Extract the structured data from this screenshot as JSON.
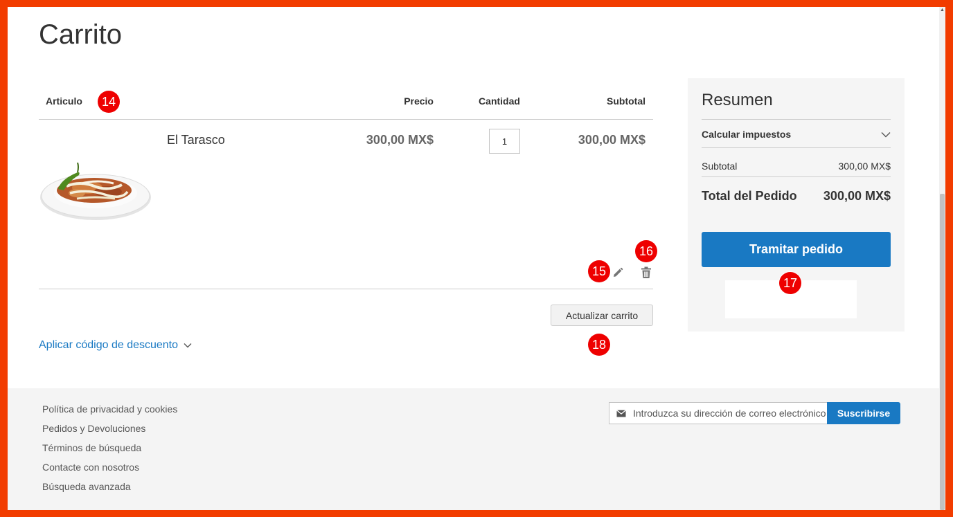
{
  "page": {
    "title": "Carrito"
  },
  "cart": {
    "headers": {
      "item": "Articulo",
      "price": "Precio",
      "qty": "Cantidad",
      "subtotal": "Subtotal"
    },
    "items": [
      {
        "name": "El Tarasco",
        "price": "300,00 MX$",
        "qty": "1",
        "subtotal": "300,00 MX$"
      }
    ],
    "update_label": "Actualizar carrito",
    "discount_label": "Aplicar código de descuento"
  },
  "summary": {
    "title": "Resumen",
    "tax_label": "Calcular impuestos",
    "subtotal_label": "Subtotal",
    "subtotal_value": "300,00 MX$",
    "total_label": "Total del Pedido",
    "total_value": "300,00 MX$",
    "checkout_label": "Tramitar pedido"
  },
  "footer": {
    "links": [
      "Política de privacidad y cookies",
      "Pedidos y Devoluciones",
      "Términos de búsqueda",
      "Contacte con nosotros",
      "Búsqueda avanzada"
    ],
    "newsletter_placeholder": "Introduzca su dirección de correo electrónico",
    "subscribe_label": "Suscribirse"
  },
  "badges": [
    "14",
    "15",
    "16",
    "17",
    "18"
  ],
  "icons": {
    "edit": "pencil-icon",
    "delete": "trash-icon",
    "tax_toggle": "chevron-down-icon",
    "discount_toggle": "chevron-down-icon",
    "newsletter": "envelope-icon"
  },
  "colors": {
    "frame": "#f23c00",
    "accent": "#1979c3",
    "badge": "#ee0000"
  }
}
